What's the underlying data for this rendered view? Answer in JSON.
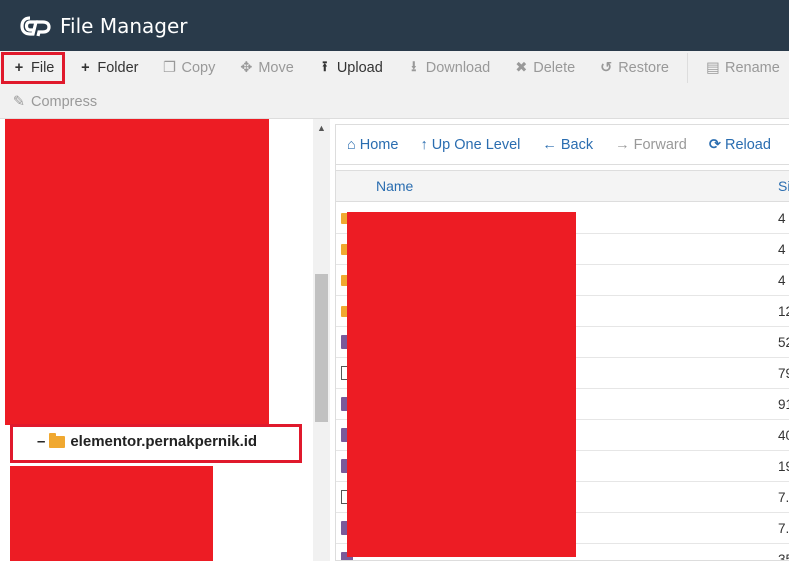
{
  "header": {
    "title": "File Manager"
  },
  "toolbar": {
    "row1": [
      {
        "label": "File",
        "icon": "plus-icon",
        "glyph": "+",
        "disabled": false,
        "name": "new-file-button"
      },
      {
        "label": "Folder",
        "icon": "plus-icon",
        "glyph": "+",
        "disabled": false,
        "name": "new-folder-button"
      },
      {
        "label": "Copy",
        "icon": "copy-icon",
        "glyph": "❐",
        "disabled": true,
        "name": "copy-button"
      },
      {
        "label": "Move",
        "icon": "move-icon",
        "glyph": "✥",
        "disabled": true,
        "name": "move-button"
      },
      {
        "label": "Upload",
        "icon": "upload-icon",
        "glyph": "⭱",
        "disabled": false,
        "name": "upload-button"
      },
      {
        "label": "Download",
        "icon": "download-icon",
        "glyph": "⭳",
        "disabled": true,
        "name": "download-button"
      },
      {
        "label": "Delete",
        "icon": "delete-icon",
        "glyph": "✖",
        "disabled": true,
        "name": "delete-button"
      },
      {
        "label": "Restore",
        "icon": "restore-icon",
        "glyph": "↺",
        "disabled": true,
        "name": "restore-button"
      },
      {
        "label": "Rename",
        "icon": "rename-icon",
        "glyph": "▤",
        "disabled": true,
        "name": "rename-button"
      }
    ],
    "row2": [
      {
        "label": "Compress",
        "icon": "compress-icon",
        "glyph": "✎",
        "disabled": true,
        "name": "compress-button"
      }
    ]
  },
  "tree": {
    "selected_domain": "elementor.pernakpernik.id",
    "expand_glyph": "–"
  },
  "nav": [
    {
      "label": "Home",
      "icon": "home-icon",
      "glyph": "⌂",
      "disabled": false,
      "name": "home-button"
    },
    {
      "label": "Up One Level",
      "icon": "up-level-icon",
      "glyph": "↑",
      "disabled": false,
      "name": "up-one-level-button"
    },
    {
      "label": "Back",
      "icon": "back-arrow-icon",
      "glyph": "←",
      "disabled": false,
      "name": "back-button"
    },
    {
      "label": "Forward",
      "icon": "forward-arrow-icon",
      "glyph": "→",
      "disabled": true,
      "name": "forward-button"
    },
    {
      "label": "Reload",
      "icon": "reload-icon",
      "glyph": "⟳",
      "disabled": false,
      "name": "reload-button"
    }
  ],
  "table": {
    "columns": {
      "name": "Name",
      "size": "Si"
    },
    "rows": [
      {
        "type": "folder",
        "size": "4"
      },
      {
        "type": "folder",
        "size": "4"
      },
      {
        "type": "folder",
        "size": "4"
      },
      {
        "type": "folder",
        "size": "12"
      },
      {
        "type": "file",
        "size": "52"
      },
      {
        "type": "doc",
        "size": "79"
      },
      {
        "type": "file",
        "size": "91"
      },
      {
        "type": "file",
        "size": "40"
      },
      {
        "type": "file",
        "size": "19"
      },
      {
        "type": "doc",
        "size": "7."
      },
      {
        "type": "file",
        "size": "7."
      },
      {
        "type": "file",
        "size": "35"
      }
    ]
  },
  "colors": {
    "header_bg": "#293a4a",
    "accent": "#2a6db0",
    "highlight": "#e0192c",
    "redaction": "#ed1c24",
    "folder": "#f0a830"
  }
}
